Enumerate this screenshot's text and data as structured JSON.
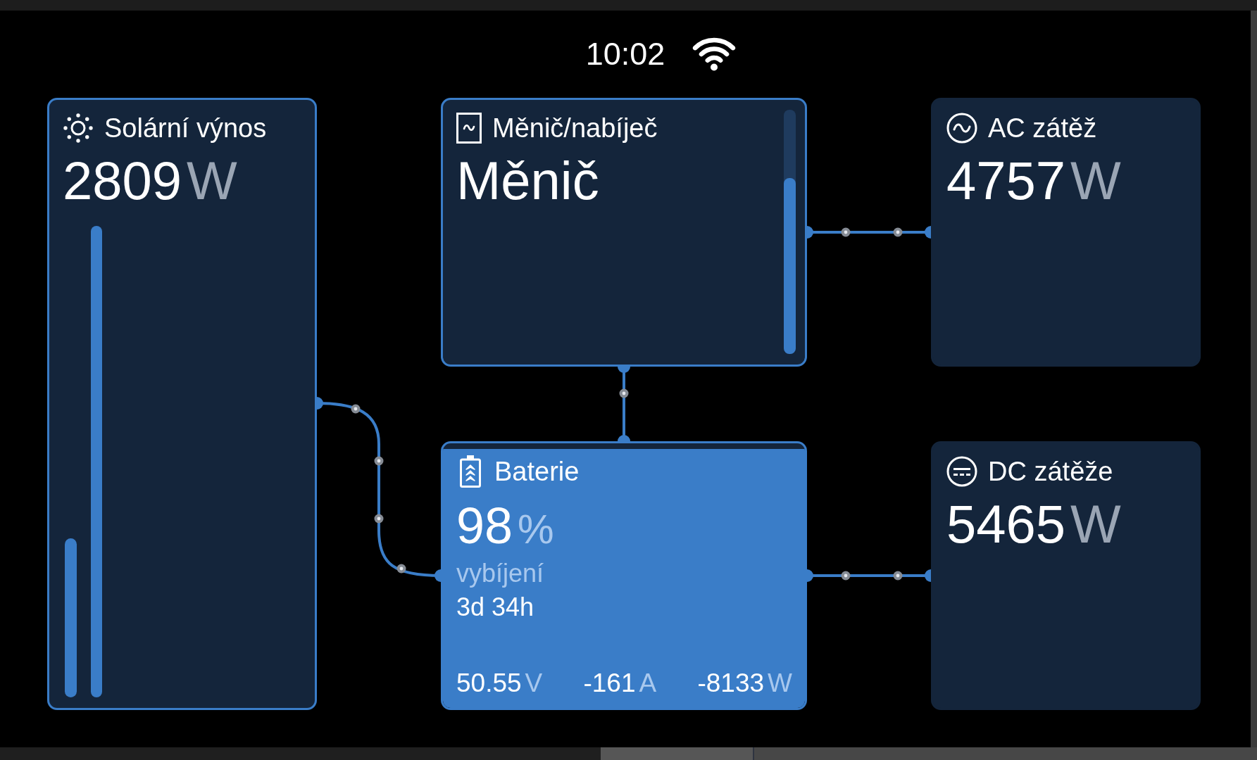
{
  "status_bar": {
    "time": "10:02"
  },
  "widgets": [
    {
      "kind": "solar",
      "title": "Solární výnos",
      "value": "2809",
      "unit": "W"
    },
    {
      "kind": "inverter",
      "title": "Měnič/nabíječ",
      "value": "Měnič",
      "level": 0.72
    },
    {
      "kind": "ac_loads",
      "title": "AC zátěž",
      "value": "4757",
      "unit": "W"
    },
    {
      "kind": "battery",
      "title": "Baterie",
      "value": "98",
      "unit": "%",
      "level": 0.98,
      "state": "vybíjení",
      "remaining": "3d 34h",
      "readings": [
        {
          "value": "50.55",
          "unit": "V"
        },
        {
          "value": "-161",
          "unit": "A"
        },
        {
          "value": "-8133",
          "unit": "W"
        }
      ]
    },
    {
      "kind": "dc_loads",
      "title": "DC zátěže",
      "value": "5465",
      "unit": "W"
    }
  ]
}
